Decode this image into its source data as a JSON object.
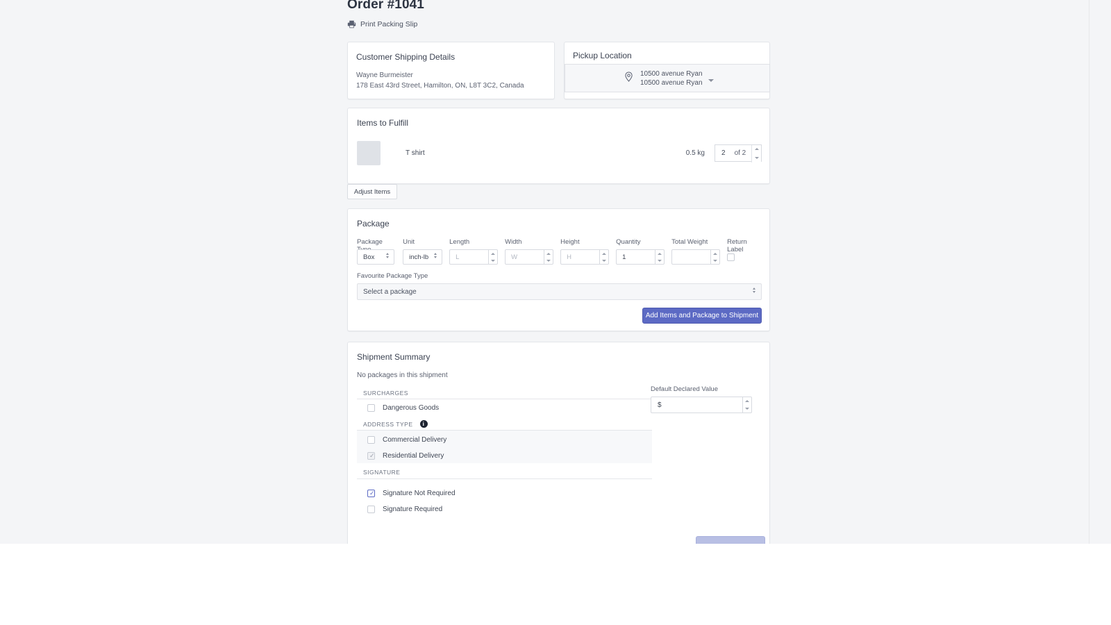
{
  "header": {
    "order_title": "Order #1041",
    "print_packing_slip": "Print Packing Slip"
  },
  "customer": {
    "title": "Customer Shipping Details",
    "name": "Wayne Burmeister",
    "address": "178 East 43rd Street, Hamilton, ON, L8T 3C2, Canada"
  },
  "pickup": {
    "title": "Pickup Location",
    "line1": "10500 avenue Ryan",
    "line2": "10500 avenue Ryan"
  },
  "items": {
    "title": "Items to Fulfill",
    "adjust_button": "Adjust Items",
    "rows": [
      {
        "name": "T shirt",
        "weight": "0.5 kg",
        "quantity": "2",
        "of_label": "of 2"
      }
    ]
  },
  "package": {
    "title": "Package",
    "fields": {
      "package_type_label": "Package Type",
      "package_type_value": "Box",
      "unit_label": "Unit",
      "unit_value": "inch-lb",
      "length_label": "Length",
      "length_placeholder": "L",
      "length_value": "",
      "width_label": "Width",
      "width_placeholder": "W",
      "width_value": "",
      "height_label": "Height",
      "height_placeholder": "H",
      "height_value": "",
      "quantity_label": "Quantity",
      "quantity_value": "1",
      "total_weight_label": "Total Weight",
      "total_weight_value": "",
      "return_label_label": "Return Label"
    },
    "favourite_label": "Favourite Package Type",
    "favourite_value": "Select a package",
    "add_button": "Add Items and Package to Shipment"
  },
  "summary": {
    "title": "Shipment Summary",
    "no_packages": "No packages in this shipment",
    "surcharges_head": "SURCHARGES",
    "dangerous_goods": "Dangerous Goods",
    "address_type_head": "ADDRESS TYPE",
    "info_glyph": "i",
    "commercial_delivery": "Commercial Delivery",
    "residential_delivery": "Residential Delivery",
    "signature_head": "SIGNATURE",
    "signature_not_required": "Signature Not Required",
    "signature_required": "Signature Required",
    "declared_value_label": "Default Declared Value",
    "declared_value": "$"
  },
  "colors": {
    "primary_button": "#5c6ac4",
    "page_background": "#f4f5f7",
    "card_background": "#ffffff",
    "checked_accent": "#5c6ac4"
  }
}
